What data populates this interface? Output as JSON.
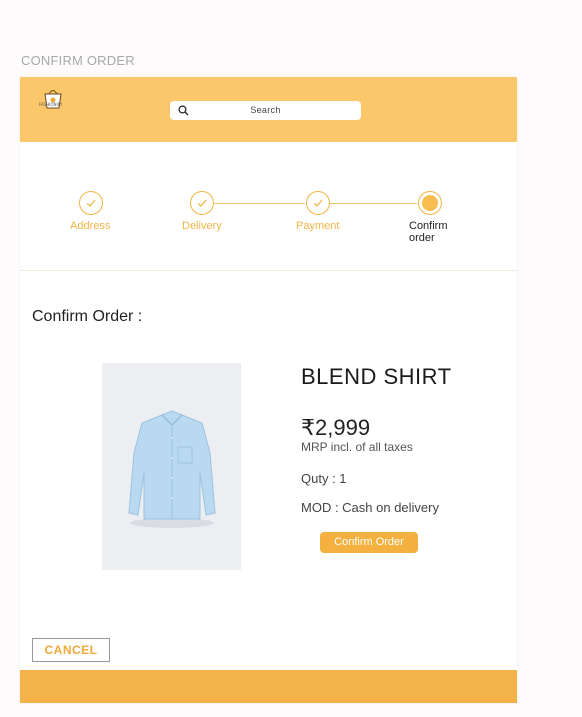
{
  "page_label": "CONFIRM ORDER",
  "header": {
    "logo_text": "FASHIONIFY",
    "search_placeholder": "Search"
  },
  "stepper": {
    "steps": [
      {
        "label": "Address",
        "status": "completed"
      },
      {
        "label": "Delivery",
        "status": "completed"
      },
      {
        "label": "Payment",
        "status": "completed"
      },
      {
        "label": "Confirm order",
        "status": "active"
      }
    ]
  },
  "section_title": "Confirm Order :",
  "product": {
    "name": "BLEND SHIRT",
    "price": "₹2,999",
    "price_note": "MRP incl. of all taxes",
    "quantity": "Quty : 1",
    "mode_of_delivery": "MOD : Cash on delivery"
  },
  "buttons": {
    "confirm": "Confirm Order",
    "cancel": "CANCEL"
  },
  "colors": {
    "header": "#fcc66a",
    "accent": "#f0b545",
    "button": "#f4b13f",
    "footer": "#f4b34a"
  }
}
